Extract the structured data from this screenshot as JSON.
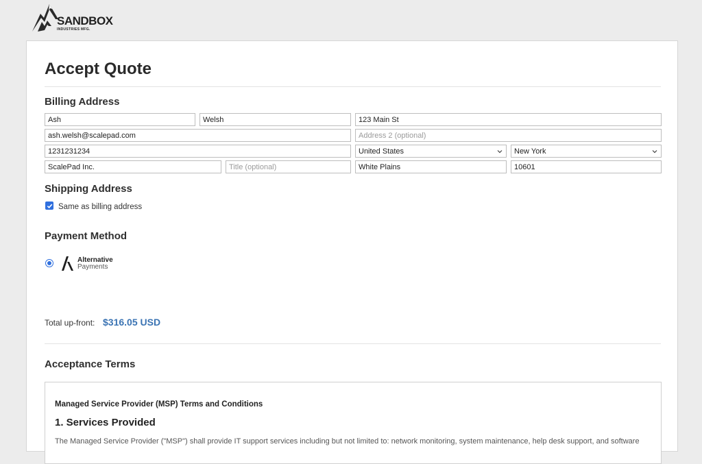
{
  "logo": {
    "brand": "SANDBOX",
    "sub": "INDUSTRIES MFG."
  },
  "page": {
    "title": "Accept Quote"
  },
  "billing": {
    "heading": "Billing Address",
    "first_name": "Ash",
    "last_name": "Welsh",
    "address1": "123 Main St",
    "email": "ash.welsh@scalepad.com",
    "address2_placeholder": "Address 2 (optional)",
    "phone": "1231231234",
    "country": "United States",
    "state": "New York",
    "company": "ScalePad Inc.",
    "title_placeholder": "Title (optional)",
    "city": "White Plains",
    "zip": "10601"
  },
  "shipping": {
    "heading": "Shipping Address",
    "same_label": "Same as billing address",
    "same_checked": true
  },
  "payment": {
    "heading": "Payment Method",
    "option_line1": "Alternative",
    "option_line2": "Payments",
    "selected": true
  },
  "total": {
    "label": "Total up-front:",
    "value": "$316.05 USD"
  },
  "terms": {
    "heading": "Acceptance Terms",
    "doc_title": "Managed Service Provider (MSP) Terms and Conditions",
    "section1": "1. Services Provided",
    "para_start": "The Managed Service Provider (\"MSP\") shall provide IT support services including but not limited to: network monitoring, system maintenance, help desk support, and software"
  },
  "colors": {
    "accent": "#2f6fde",
    "total": "#3a73b3"
  }
}
